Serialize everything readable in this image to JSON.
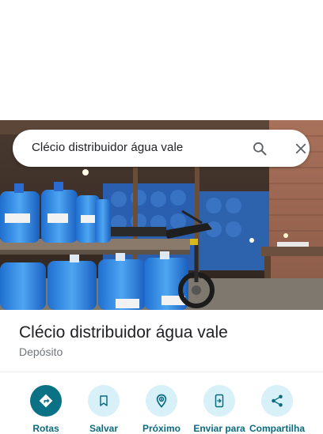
{
  "search": {
    "query": "Clécio distribuidor água vale",
    "search_icon": "search-icon",
    "close_icon": "close-icon"
  },
  "photo": {
    "subject": "water-jug-depot-photo"
  },
  "place": {
    "title": "Clécio distribuidor água vale",
    "category": "Depósito"
  },
  "actions": [
    {
      "label": "Rotas",
      "icon": "directions-icon"
    },
    {
      "label": "Salvar",
      "icon": "bookmark-icon"
    },
    {
      "label": "Próximo",
      "icon": "nearby-icon"
    },
    {
      "label": "Enviar para",
      "icon": "send-to-phone-icon"
    },
    {
      "label": "Compartilha",
      "icon": "share-icon"
    }
  ],
  "colors": {
    "primary_action": "#0b7285",
    "action_bg": "#d8f0f8",
    "action_text": "#0b6b7e"
  }
}
